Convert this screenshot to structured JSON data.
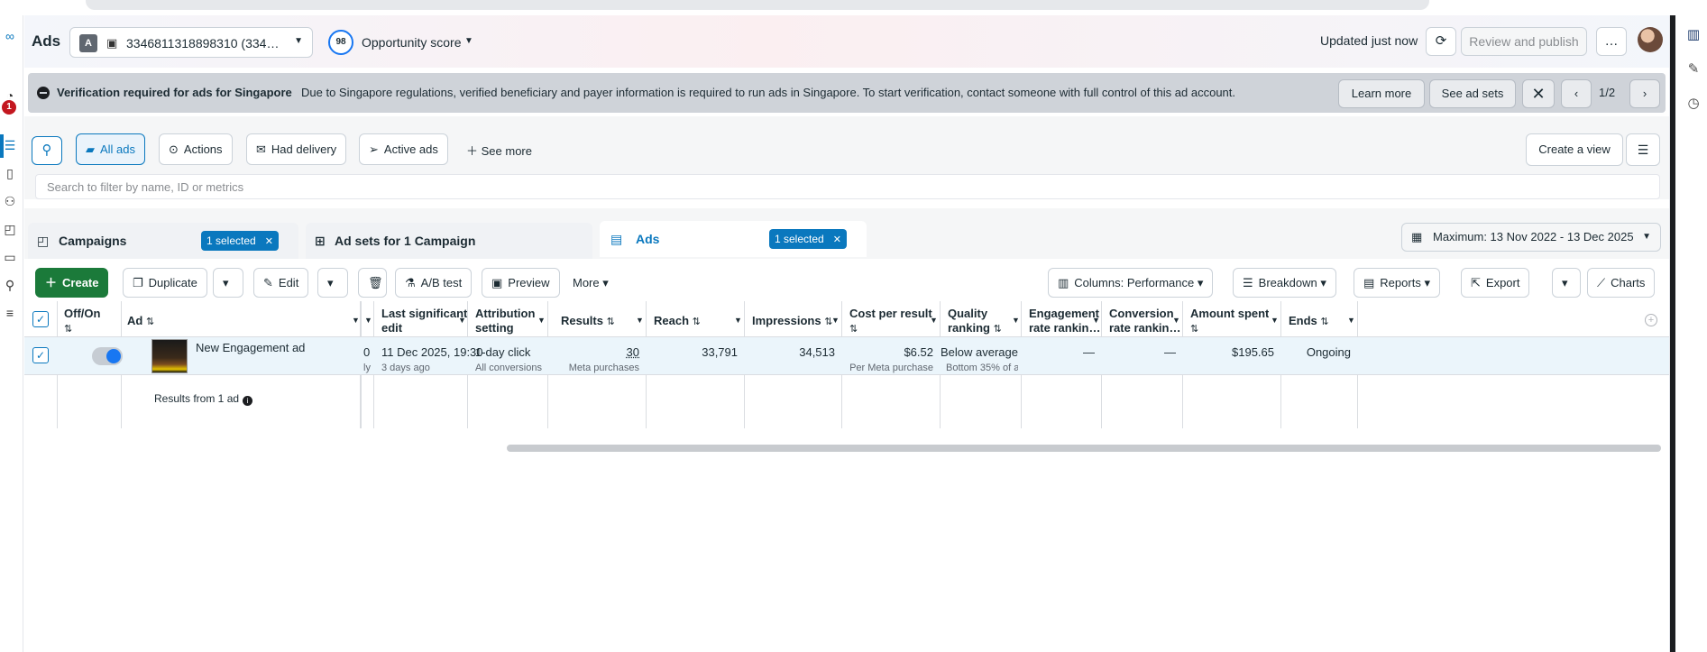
{
  "app": {
    "title": "Ads"
  },
  "account": {
    "avatar_letter": "A",
    "name": "3346811318898310 (334…"
  },
  "opportunity": {
    "score": "98",
    "label": "Opportunity score"
  },
  "header": {
    "updated": "Updated just now",
    "review_label": "Review and publish",
    "more_icon": "…"
  },
  "left_rail": {
    "badge": "1"
  },
  "banner": {
    "title": "Verification required for ads for Singapore",
    "message": "Due to Singapore regulations, verified beneficiary and payer information is required to run ads in Singapore. To start verification, contact someone with full control of this ad account.",
    "learn_more": "Learn more",
    "see_ad_sets": "See ad sets",
    "pager": "1/2"
  },
  "filters": {
    "chips": [
      "All ads",
      "Actions",
      "Had delivery",
      "Active ads"
    ],
    "see_more": "See more",
    "create_view": "Create a view",
    "search_placeholder": "Search to filter by name, ID or metrics"
  },
  "tabs": {
    "campaigns": "Campaigns",
    "campaigns_selected": "1 selected",
    "adsets": "Ad sets for 1 Campaign",
    "ads": "Ads",
    "ads_selected": "1 selected",
    "date_range": "Maximum: 13 Nov 2022 - 13 Dec 2025"
  },
  "toolbar": {
    "create": "Create",
    "duplicate": "Duplicate",
    "edit": "Edit",
    "ab_test": "A/B test",
    "preview": "Preview",
    "more": "More",
    "columns": "Columns: Performance",
    "breakdown": "Breakdown",
    "reports": "Reports",
    "export": "Export",
    "charts": "Charts"
  },
  "table": {
    "headers": {
      "offon": "Off/On",
      "ad": "Ad",
      "last_edit_1": "Last significant",
      "last_edit_2": "edit",
      "attribution_1": "Attribution",
      "attribution_2": "setting",
      "results": "Results",
      "reach": "Reach",
      "impressions": "Impressions",
      "cpr": "Cost per result",
      "quality_1": "Quality",
      "quality_2": "ranking",
      "engagement_1": "Engagement",
      "engagement_2": "rate rankin…",
      "conversion_1": "Conversion",
      "conversion_2": "rate rankin…",
      "spent": "Amount spent",
      "ends": "Ends"
    },
    "row": {
      "ad_name": "New Engagement ad",
      "clipped_value": "0",
      "clipped_sub": "ly",
      "last_edit": "11 Dec 2025, 19:30",
      "last_edit_sub": "3 days ago",
      "attribution": "1-day click",
      "attribution_sub": "All conversions",
      "results": "30",
      "results_sub": "Meta purchases",
      "reach": "33,791",
      "impressions": "34,513",
      "cpr": "$6.52",
      "cpr_sub": "Per Meta purchase",
      "quality": "Below average",
      "quality_sub": "Bottom 35% of a…",
      "engagement": "—",
      "conversion": "—",
      "spent": "$195.65",
      "ends": "Ongoing"
    },
    "footer": "Results from 1 ad"
  }
}
